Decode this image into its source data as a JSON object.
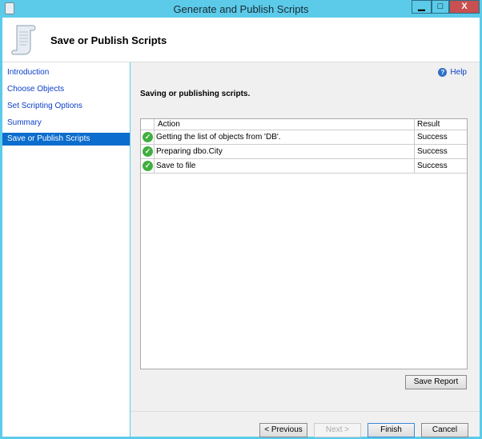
{
  "window": {
    "title": "Generate and Publish Scripts",
    "minimize": "▁",
    "maximize": "□",
    "close": "X"
  },
  "header": {
    "title": "Save or Publish Scripts"
  },
  "nav": {
    "items": [
      {
        "label": "Introduction"
      },
      {
        "label": "Choose Objects"
      },
      {
        "label": "Set Scripting Options"
      },
      {
        "label": "Summary"
      },
      {
        "label": "Save or Publish Scripts",
        "selected": true
      }
    ]
  },
  "content": {
    "help": "Help",
    "heading": "Saving or publishing scripts.",
    "table": {
      "columns": [
        "Action",
        "Result"
      ],
      "rows": [
        {
          "action": "Getting the list of objects from 'DB'.",
          "result": "Success"
        },
        {
          "action": "Preparing dbo.City",
          "result": "Success"
        },
        {
          "action": "Save to file",
          "result": "Success"
        }
      ]
    },
    "save_report": "Save Report"
  },
  "footer": {
    "previous": "< Previous",
    "next": "Next >",
    "finish": "Finish",
    "cancel": "Cancel"
  }
}
